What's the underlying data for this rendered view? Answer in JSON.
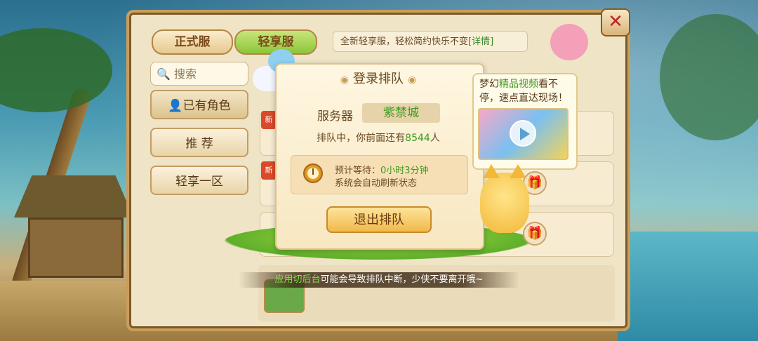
{
  "header": {
    "tabs": [
      {
        "label": "正式服"
      },
      {
        "label": "轻享服"
      }
    ],
    "notice": {
      "text": "全新轻享服，轻松简约快乐不变",
      "link": "[详情]"
    },
    "close_icon": "close-icon"
  },
  "sidebar": {
    "search_placeholder": "搜索",
    "items": [
      {
        "label": "已有角色",
        "icon": "person-icon"
      },
      {
        "label": "推  荐"
      },
      {
        "label": "轻享一区"
      }
    ]
  },
  "server_list": {
    "badges": [
      "新",
      "新"
    ]
  },
  "queue_dialog": {
    "title": "登录排队",
    "server_label": "服务器",
    "server_name": "紫禁城",
    "queue_prefix": "排队中，你前面还有",
    "queue_count": "8544",
    "queue_suffix": "人",
    "wait_label": "预计等待：",
    "wait_value": "0小时3分钟",
    "auto_refresh": "系统会自动刷新状态",
    "exit_button": "退出排队"
  },
  "promo": {
    "text_prefix": "梦幻",
    "text_highlight": "精品视频",
    "text_suffix": "看不停，速点直达现场！"
  },
  "bottom_tip": {
    "highlight": "应用切后台",
    "text": "可能会导致排队中断，少侠不要离开哦~"
  },
  "colors": {
    "accent_green": "#3c9a1e",
    "panel_bg": "#efe4c6",
    "frame_brown": "#c99d5a"
  }
}
